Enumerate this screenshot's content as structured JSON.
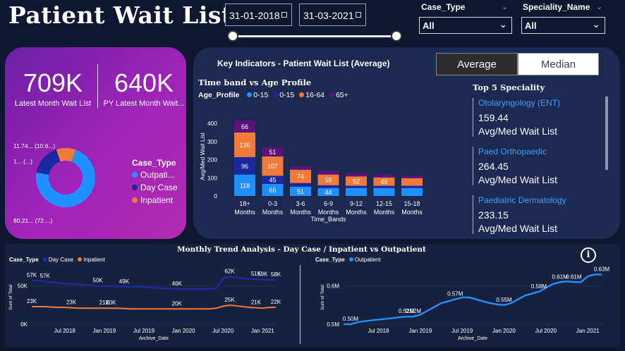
{
  "header": {
    "title": "Patient Wait List",
    "date_from": "31-01-2018",
    "date_to": "31-03-2021",
    "case_type_label": "Case_Type",
    "case_type_value": "All",
    "speciality_label": "Speciality_Name",
    "speciality_value": "All"
  },
  "kpis": {
    "latest": {
      "value": "709K",
      "label": "Latest Month Wait List"
    },
    "py_latest": {
      "value": "640K",
      "label": "PY Latest Month Wait..."
    }
  },
  "donut": {
    "labels": [
      "11.74... (10.6...)",
      "1... (...)",
      "80.21... (72....)"
    ],
    "legend_title": "Case_Type",
    "legend": [
      {
        "name": "Outpati...",
        "color": "#1e90ff"
      },
      {
        "name": "Day Case",
        "color": "#1a2a9e"
      },
      {
        "name": "Inpatient",
        "color": "#f07a3a"
      }
    ],
    "slices": [
      {
        "name": "Outpatient",
        "fraction": 0.7221,
        "color": "#1e90ff"
      },
      {
        "name": "Day Case",
        "color": "#1a2a9e",
        "fraction": 0.1717
      },
      {
        "name": "Inpatient",
        "color": "#f07a3a",
        "fraction": 0.1062
      }
    ]
  },
  "key_indicators": {
    "title": "Key Indicators - Patient Wait List (Average)",
    "toggle_average": "Average",
    "toggle_median": "Median",
    "chart_title": "Time band vs Age Profile",
    "legend_title": "Age_Profile",
    "legend": [
      {
        "name": "0-15",
        "color": "#1e90ff"
      },
      {
        "name": "0-15",
        "color": "#1a2a9e"
      },
      {
        "name": "16-64",
        "color": "#f07a3a"
      },
      {
        "name": "65+",
        "color": "#5a137a"
      }
    ],
    "top5": {
      "title": "Top 5 Speciality",
      "items": [
        {
          "name": "Otolaryngology (ENT)",
          "value": "159.44",
          "label": "Avg/Med Wait List"
        },
        {
          "name": "Paed Orthopaedic",
          "value": "264.45",
          "label": "Avg/Med Wait List"
        },
        {
          "name": "Paediatric Dermatology",
          "value": "233.15",
          "label": "Avg/Med Wait List"
        }
      ]
    }
  },
  "chart_data": [
    {
      "type": "bar",
      "title": "Time band vs Age Profile",
      "xlabel": "Time_Bands",
      "ylabel": "Avg/Med Wait List",
      "ylim": [
        0,
        420
      ],
      "yticks": [
        0,
        100,
        200,
        300,
        400
      ],
      "categories": [
        "18+ Months",
        "0-3 Months",
        "3-6 Months",
        "6-9 Months",
        "9-12 Months",
        "12-15 Months",
        "15-18 Months"
      ],
      "series": [
        {
          "name": "0-15",
          "color": "#1e90ff",
          "values": [
            118,
            66,
            51,
            44,
            44,
            44,
            44
          ],
          "labels": [
            "118",
            "66",
            "51",
            "44",
            "",
            "",
            ""
          ]
        },
        {
          "name": "0-15",
          "color": "#1a2a9e",
          "values": [
            96,
            45,
            20,
            15,
            12,
            12,
            12
          ],
          "labels": [
            "96",
            "45",
            "",
            "",
            "",
            "",
            ""
          ]
        },
        {
          "name": "16-64",
          "color": "#f07a3a",
          "values": [
            136,
            107,
            74,
            59,
            52,
            46,
            42
          ],
          "labels": [
            "136",
            "107",
            "74",
            "59",
            "52",
            "46",
            ""
          ]
        },
        {
          "name": "65+",
          "color": "#5a137a",
          "values": [
            66,
            51,
            20,
            20,
            18,
            17,
            15
          ],
          "labels": [
            "66",
            "51",
            "",
            "",
            "",
            "",
            ""
          ]
        }
      ],
      "legend": "top-left",
      "grid": false
    },
    {
      "type": "line",
      "title": "Monthly Trend Analysis - Day Case / Inpatient vs Outpatient",
      "xlabel": "Archive_Date",
      "ylabel": "Sum of Total",
      "legend_title": "Case_Type",
      "xticks": [
        "Jul 2018",
        "Jan 2019",
        "Jul 2019",
        "Jan 2020",
        "Jul 2020",
        "Jan 2021"
      ],
      "yticks": [
        "0K",
        "50K"
      ],
      "ylim": [
        0,
        70000
      ],
      "series": [
        {
          "name": "Day Case",
          "color": "#1a2aae",
          "values": [
            57000,
            57000,
            56000,
            55000,
            54000,
            53000,
            52500,
            52000,
            51500,
            51000,
            50000,
            50000,
            49500,
            49000,
            49000,
            49000,
            49000,
            48500,
            48000,
            47500,
            47000,
            46500,
            46000,
            46000,
            46000,
            46000,
            46000,
            46000,
            47000,
            60000,
            62000,
            61000,
            60000,
            59000,
            59000,
            58500,
            58000,
            58000
          ]
        },
        {
          "name": "Inpatient",
          "color": "#f07a3a",
          "values": [
            23000,
            23000,
            23000,
            22500,
            22000,
            22000,
            21500,
            21000,
            21000,
            21000,
            21000,
            21000,
            21000,
            21000,
            20500,
            20000,
            20000,
            20000,
            20000,
            20000,
            20000,
            20000,
            20000,
            20000,
            20000,
            20000,
            20000,
            20000,
            21000,
            23500,
            25000,
            24000,
            23000,
            22000,
            21500,
            21000,
            22000,
            22000
          ]
        }
      ],
      "data_labels": [
        {
          "series": 0,
          "i": 0,
          "text": "57K"
        },
        {
          "series": 0,
          "i": 2,
          "text": "57K"
        },
        {
          "series": 0,
          "i": 10,
          "text": "50K"
        },
        {
          "series": 0,
          "i": 14,
          "text": "49K"
        },
        {
          "series": 0,
          "i": 22,
          "text": "46K"
        },
        {
          "series": 0,
          "i": 30,
          "text": "62K"
        },
        {
          "series": 0,
          "i": 34,
          "text": "51K"
        },
        {
          "series": 0,
          "i": 35,
          "text": "59K"
        },
        {
          "series": 0,
          "i": 37,
          "text": "58K"
        },
        {
          "series": 1,
          "i": 0,
          "text": "23K"
        },
        {
          "series": 1,
          "i": 6,
          "text": "23K"
        },
        {
          "series": 1,
          "i": 11,
          "text": "21K"
        },
        {
          "series": 1,
          "i": 12,
          "text": "20K"
        },
        {
          "series": 1,
          "i": 22,
          "text": "20K"
        },
        {
          "series": 1,
          "i": 30,
          "text": "25K"
        },
        {
          "series": 1,
          "i": 34,
          "text": "21K"
        },
        {
          "series": 1,
          "i": 37,
          "text": "22K"
        }
      ]
    },
    {
      "type": "line",
      "xlabel": "Archive_Date",
      "ylabel": "Sum of Total",
      "legend_title": "Case_Type",
      "xticks": [
        "Jul 2018",
        "Jan 2019",
        "Jul 2019",
        "Jan 2020",
        "Jul 2020",
        "Jan 2021"
      ],
      "yticks": [
        "0.5M",
        "0.6M"
      ],
      "ylim": [
        0.5,
        0.64
      ],
      "series": [
        {
          "name": "Outpatient",
          "color": "#1e90ff",
          "values": [
            0.5,
            0.5,
            0.505,
            0.508,
            0.51,
            0.512,
            0.514,
            0.516,
            0.518,
            0.52,
            0.52,
            0.525,
            0.535,
            0.545,
            0.555,
            0.56,
            0.565,
            0.57,
            0.57,
            0.565,
            0.56,
            0.555,
            0.552,
            0.55,
            0.555,
            0.565,
            0.575,
            0.58,
            0.585,
            0.595,
            0.605,
            0.61,
            0.612,
            0.61,
            0.61,
            0.625,
            0.63,
            0.63
          ]
        }
      ],
      "data_labels": [
        {
          "series": 0,
          "i": 1,
          "text": "0.50M"
        },
        {
          "series": 0,
          "i": 9,
          "text": "0.52M"
        },
        {
          "series": 0,
          "i": 10,
          "text": "0.52M"
        },
        {
          "series": 0,
          "i": 16,
          "text": "0.57M"
        },
        {
          "series": 0,
          "i": 23,
          "text": "0.55M"
        },
        {
          "series": 0,
          "i": 28,
          "text": "0.58M"
        },
        {
          "series": 0,
          "i": 31,
          "text": "0.61M"
        },
        {
          "series": 0,
          "i": 33,
          "text": "0.61M"
        },
        {
          "series": 0,
          "i": 37,
          "text": "0.63M"
        }
      ]
    }
  ],
  "trend": {
    "title": "Monthly Trend Analysis - Day Case / Inpatient vs Outpatient",
    "left_legend_title": "Case_Type",
    "left_legend": [
      {
        "name": "Day Case",
        "color": "#1a2aae"
      },
      {
        "name": "Inpatient",
        "color": "#f07a3a"
      }
    ],
    "right_legend_title": "Case_Type",
    "right_legend": [
      {
        "name": "Outpatient",
        "color": "#1e90ff"
      }
    ],
    "info_icon": "info-icon"
  }
}
